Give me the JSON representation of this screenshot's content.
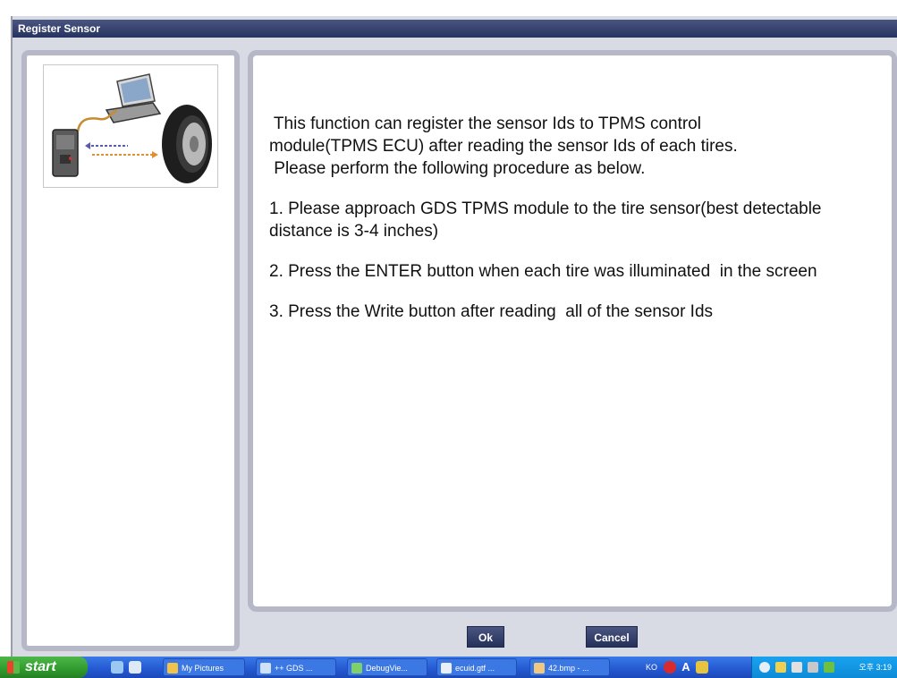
{
  "window": {
    "title": "Register Sensor"
  },
  "instructions": {
    "intro_lines": [
      " This function can register the sensor Ids to TPMS control",
      "module(TPMS ECU) after reading the sensor Ids of each tires.",
      " Please perform the following procedure as below."
    ],
    "step1": "1. Please approach GDS TPMS module to the tire sensor(best detectable distance is 3-4 inches)",
    "step2": "2. Press the ENTER button when each tire was illuminated  in the screen",
    "step3": "3. Press the Write button after reading  all of the sensor Ids"
  },
  "buttons": {
    "ok": "Ok",
    "cancel": "Cancel"
  },
  "taskbar": {
    "start_label": "start",
    "tasks": [
      "My Pictures",
      "++ GDS ...",
      "DebugVie...",
      "ecuid.gtf ...",
      "42.bmp - ..."
    ],
    "language": "KO",
    "clock": "오후 3:19"
  },
  "colors": {
    "title_bar": "#2f3b68",
    "panel_border": "#b6b8c8",
    "window_bg": "#d8dae4",
    "taskbar": "#2458d0",
    "start_button": "#2f9a2d"
  },
  "icons": {
    "illustration": "scanner-laptop-tire-icon",
    "start": "windows-logo-icon"
  }
}
